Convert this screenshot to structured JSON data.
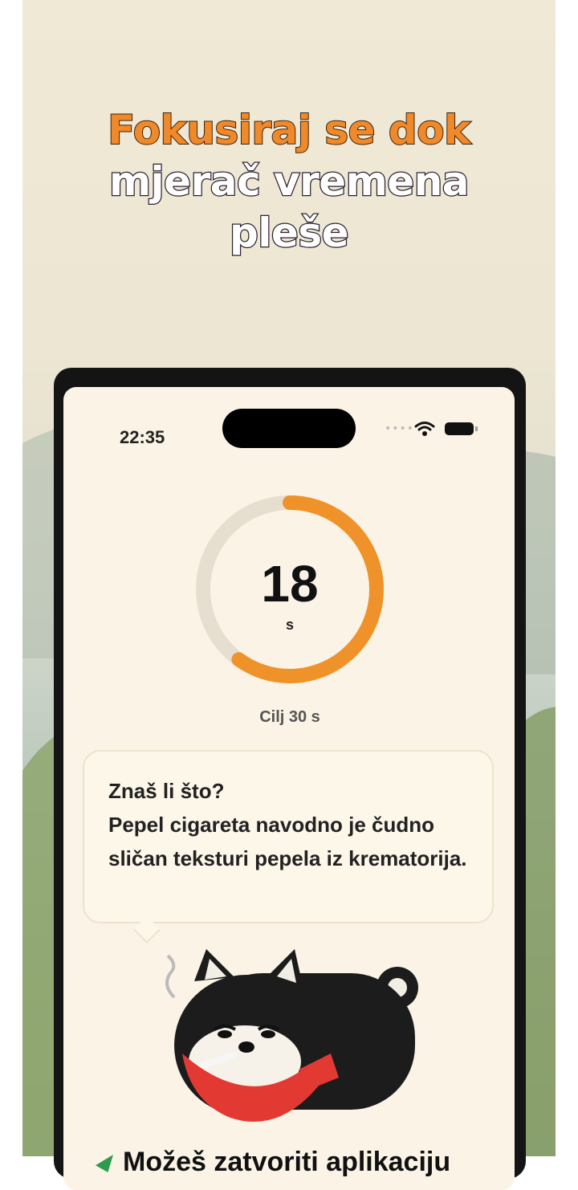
{
  "headline": {
    "line1": "Fokusiraj se dok",
    "line2": "mjerač vremena",
    "line3": "pleše"
  },
  "status_bar": {
    "time": "22:35",
    "signal_icon": "signal-dots-icon",
    "wifi_icon": "wifi-icon",
    "battery_icon": "battery-icon"
  },
  "timer": {
    "value": "18",
    "unit": "s",
    "goal": "Cilj 30 s",
    "progress_fraction": 0.6,
    "progress_color": "#f0922a",
    "track_color": "#e6dfd0"
  },
  "fact": {
    "title": "Znaš li što?",
    "body": "Pepel cigareta navodno je čudno sličan teksturi pepela iz krematorija."
  },
  "mascot": {
    "icon": "smoking-shiba-mascot",
    "bandana_color": "#e23a33"
  },
  "bottom": {
    "text": "Možeš zatvoriti aplikaciju"
  },
  "colors": {
    "accent": "#f0892a",
    "screen_bg": "#fbf4e6"
  }
}
